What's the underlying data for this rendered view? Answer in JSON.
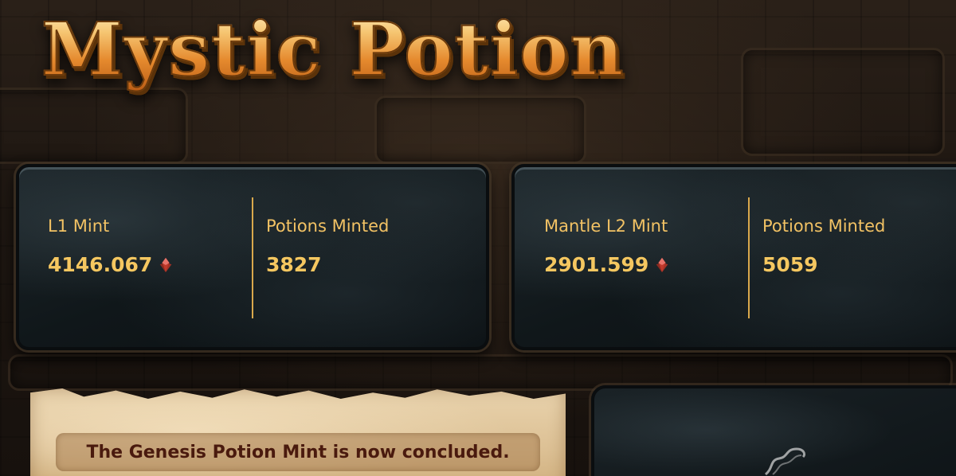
{
  "header": {
    "title": "Mystic Potion"
  },
  "stats": {
    "l1": {
      "label": "L1 Mint",
      "value": "4146.067",
      "icon": "gem-icon",
      "minted_label": "Potions Minted",
      "minted_value": "3827"
    },
    "l2": {
      "label": "Mantle L2 Mint",
      "value": "2901.599",
      "icon": "gem-icon",
      "minted_label": "Potions Minted",
      "minted_value": "5059"
    }
  },
  "notice": {
    "text": "The Genesis Potion Mint is now concluded."
  },
  "colors": {
    "accent_gold": "#f5c760",
    "notice_text": "#4a1a0e",
    "gem_red": "#c0392b"
  }
}
